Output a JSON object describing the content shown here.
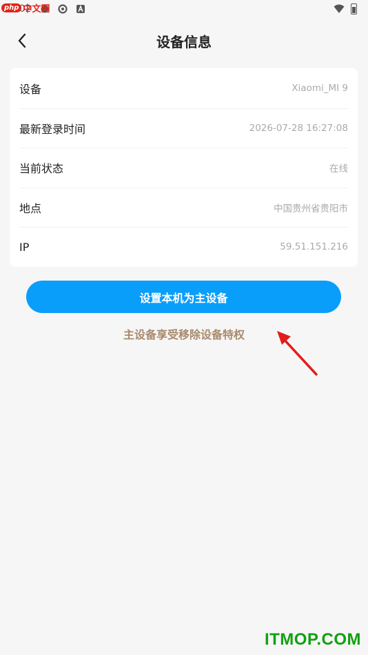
{
  "status_bar": {
    "time": "1:02",
    "icons": [
      "notification-icon",
      "settings-icon",
      "app-icon"
    ],
    "wifi_icon": "wifi-icon",
    "battery_icon": "battery-icon"
  },
  "watermark_top": {
    "badge": "php",
    "text": "中文网"
  },
  "header": {
    "back_icon": "chevron-left-icon",
    "title": "设备信息"
  },
  "device_info": [
    {
      "label": "设备",
      "value": "Xiaomi_MI 9"
    },
    {
      "label": "最新登录时间",
      "value": "2026-07-28 16:27:08"
    },
    {
      "label": "当前状态",
      "value": "在线"
    },
    {
      "label": "地点",
      "value": "中国贵州省贵阳市"
    },
    {
      "label": "IP",
      "value": "59.51.151.216"
    }
  ],
  "primary_button": {
    "label": "设置本机为主设备"
  },
  "hint_link": {
    "label": "主设备享受移除设备特权"
  },
  "colors": {
    "accent": "#0a9efb",
    "hint": "#a8896c",
    "annotation_arrow": "#e31c1c",
    "watermark": "#10a010"
  },
  "watermark_bottom": {
    "text": "ITMOP.COM"
  }
}
